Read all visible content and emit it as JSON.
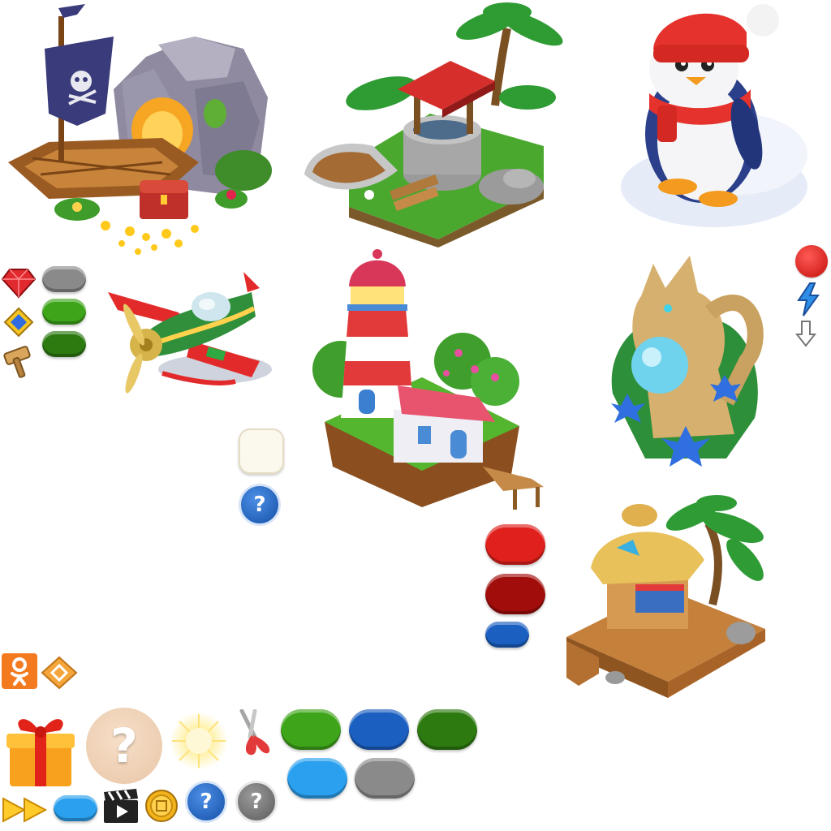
{
  "sheet": {
    "title": "",
    "sprites": [
      {
        "name": "pirate-cove",
        "kind": "building"
      },
      {
        "name": "water-well",
        "kind": "building"
      },
      {
        "name": "penguin",
        "kind": "character"
      },
      {
        "name": "propeller-plane",
        "kind": "vehicle"
      },
      {
        "name": "lighthouse",
        "kind": "building"
      },
      {
        "name": "dragon-statue",
        "kind": "decoration"
      },
      {
        "name": "straw-hut",
        "kind": "building"
      }
    ]
  },
  "icons": {
    "question_mark": "?",
    "colors": {
      "green": "#3ea51a",
      "dark_green": "#2d7a10",
      "gray": "#8a8a8a",
      "red": "#e0201c",
      "dark_red": "#a10d0a",
      "blue": "#1b5fc0",
      "light_blue": "#2aa0ee",
      "cream": "#fbf8ee",
      "ok_orange": "#f47a20"
    }
  }
}
